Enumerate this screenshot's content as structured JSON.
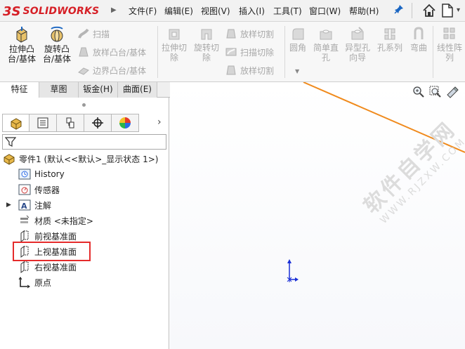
{
  "app": {
    "logo_ds": "3S",
    "logo_text": "SOLIDWORKS"
  },
  "menu": [
    {
      "label": "文件(F)"
    },
    {
      "label": "编辑(E)"
    },
    {
      "label": "视图(V)"
    },
    {
      "label": "插入(I)"
    },
    {
      "label": "工具(T)"
    },
    {
      "label": "窗口(W)"
    },
    {
      "label": "帮助(H)"
    }
  ],
  "ribbon": {
    "extrude_boss": "拉伸凸\n台/基体",
    "revolve_boss": "旋转凸\n台/基体",
    "sweep": "扫描",
    "loft_boss": "放样凸台/基体",
    "boundary_boss": "边界凸台/基体",
    "extrude_cut": "拉伸切\n除",
    "revolve_cut": "旋转切\n除",
    "loft_cut": "放样切割",
    "sweep_cut": "扫描切除",
    "boundary_cut": "放样切割",
    "fillet": "圆角",
    "simple_hole": "简单直\n孔",
    "hole_wizard": "异型孔\n向导",
    "hole_series": "孔系列",
    "wrap": "弯曲",
    "linear_pattern": "线性阵\n列"
  },
  "tabs": [
    {
      "label": "特征"
    },
    {
      "label": "草图"
    },
    {
      "label": "钣金(H)"
    },
    {
      "label": "曲面(E)"
    }
  ],
  "tree": {
    "root": "零件1  (默认<<默认>_显示状态 1>)",
    "items": [
      {
        "label": "History"
      },
      {
        "label": "传感器"
      },
      {
        "label": "注解"
      },
      {
        "label": "材质 <未指定>"
      },
      {
        "label": "前视基准面"
      },
      {
        "label": "上视基准面"
      },
      {
        "label": "右视基准面"
      },
      {
        "label": "原点"
      }
    ]
  },
  "watermark": {
    "big": "软件自学网",
    "small": "WWW.RJZXW.COM"
  },
  "colors": {
    "brand": "#d61f26",
    "sketch_line": "#f08a1c",
    "highlight": "#e52b2b",
    "axis": "#1a2fd6"
  }
}
